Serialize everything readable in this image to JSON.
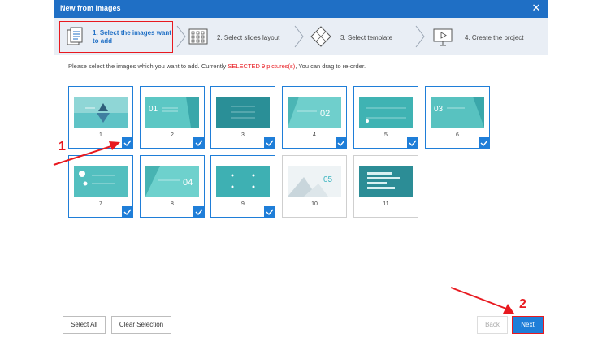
{
  "window": {
    "title": "New from images"
  },
  "steps": [
    {
      "label": "1. Select the images want to add",
      "active": true
    },
    {
      "label": "2. Select slides layout",
      "active": false
    },
    {
      "label": "3. Select template",
      "active": false
    },
    {
      "label": "4. Create the project",
      "active": false
    }
  ],
  "hint": {
    "before": "Please select the images which you want to add. Currently ",
    "highlight": "SELECTED 9 pictures(s)",
    "after": ", You can drag to re-order."
  },
  "thumbnails": [
    {
      "num": "1",
      "selected": true,
      "slide_text": ""
    },
    {
      "num": "2",
      "selected": true,
      "slide_text": "01"
    },
    {
      "num": "3",
      "selected": true,
      "slide_text": ""
    },
    {
      "num": "4",
      "selected": true,
      "slide_text": "02"
    },
    {
      "num": "5",
      "selected": true,
      "slide_text": ""
    },
    {
      "num": "6",
      "selected": true,
      "slide_text": "03"
    },
    {
      "num": "7",
      "selected": true,
      "slide_text": ""
    },
    {
      "num": "8",
      "selected": true,
      "slide_text": "04"
    },
    {
      "num": "9",
      "selected": true,
      "slide_text": ""
    },
    {
      "num": "10",
      "selected": false,
      "slide_text": "05"
    },
    {
      "num": "11",
      "selected": false,
      "slide_text": ""
    }
  ],
  "buttons": {
    "select_all": "Select All",
    "clear_selection": "Clear Selection",
    "back": "Back",
    "next": "Next"
  },
  "annotations": {
    "one": "1",
    "two": "2"
  },
  "colors": {
    "titlebar": "#1f6fc5",
    "accent": "#1f7ed8",
    "annotation": "#e8191f",
    "slide_teal": "#3fb8b8"
  }
}
